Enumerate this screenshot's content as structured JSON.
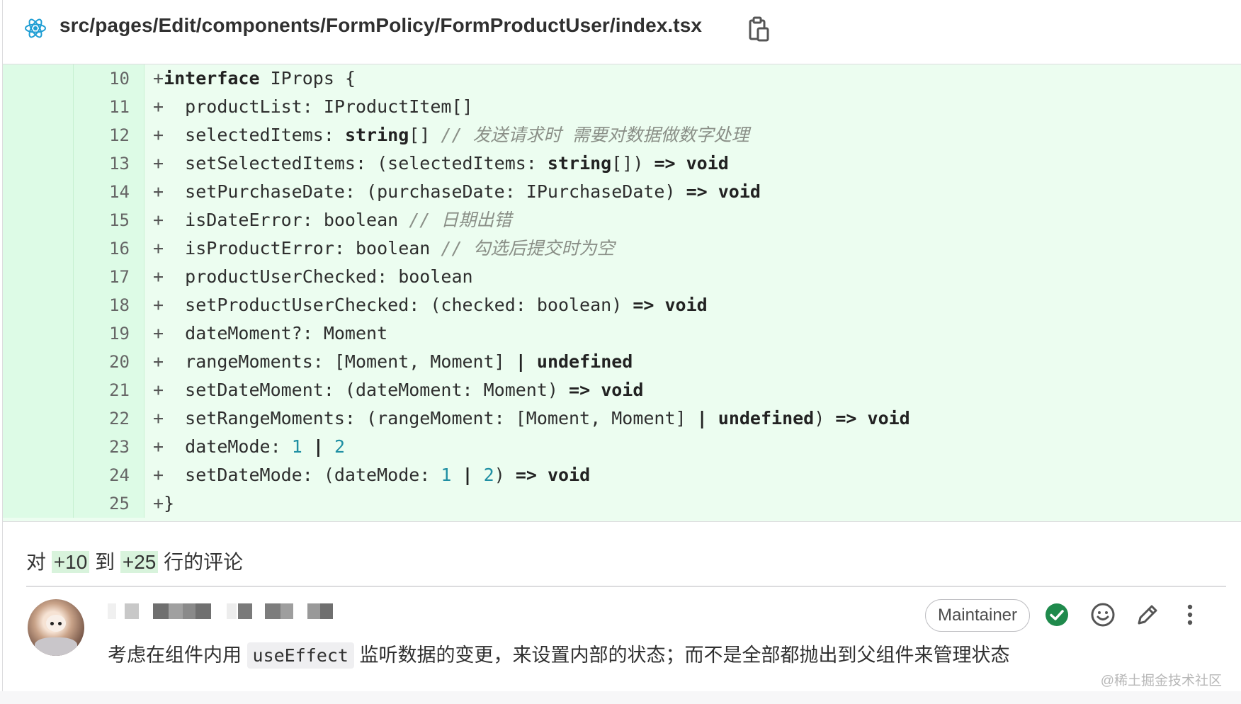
{
  "header": {
    "file_path": "src/pages/Edit/components/FormPolicy/FormProductUser/index.tsx",
    "file_icon": "react-icon",
    "copy_icon": "clipboard-icon"
  },
  "diff": {
    "lines": [
      {
        "new": "10",
        "sign": "+"
      },
      {
        "new": "11",
        "sign": "+"
      },
      {
        "new": "12",
        "sign": "+"
      },
      {
        "new": "13",
        "sign": "+"
      },
      {
        "new": "14",
        "sign": "+"
      },
      {
        "new": "15",
        "sign": "+"
      },
      {
        "new": "16",
        "sign": "+"
      },
      {
        "new": "17",
        "sign": "+"
      },
      {
        "new": "18",
        "sign": "+"
      },
      {
        "new": "19",
        "sign": "+"
      },
      {
        "new": "20",
        "sign": "+"
      },
      {
        "new": "21",
        "sign": "+"
      },
      {
        "new": "22",
        "sign": "+"
      },
      {
        "new": "23",
        "sign": "+"
      },
      {
        "new": "24",
        "sign": "+"
      },
      {
        "new": "25",
        "sign": "+"
      }
    ],
    "code": [
      [
        {
          "t": "+",
          "c": "plus"
        },
        {
          "t": "interface",
          "c": "kw"
        },
        {
          "t": " IProps {"
        }
      ],
      [
        {
          "t": "+",
          "c": "plus"
        },
        {
          "t": "  productList: IProductItem[]"
        }
      ],
      [
        {
          "t": "+",
          "c": "plus"
        },
        {
          "t": "  selectedItems: "
        },
        {
          "t": "string",
          "c": "kw"
        },
        {
          "t": "[] "
        },
        {
          "t": "// 发送请求时 需要对数据做数字处理",
          "c": "cm"
        }
      ],
      [
        {
          "t": "+",
          "c": "plus"
        },
        {
          "t": "  setSelectedItems: (selectedItems: "
        },
        {
          "t": "string",
          "c": "kw"
        },
        {
          "t": "[]) "
        },
        {
          "t": "=>",
          "c": "kw"
        },
        {
          "t": " "
        },
        {
          "t": "void",
          "c": "kw"
        }
      ],
      [
        {
          "t": "+",
          "c": "plus"
        },
        {
          "t": "  setPurchaseDate: (purchaseDate: IPurchaseDate) "
        },
        {
          "t": "=>",
          "c": "kw"
        },
        {
          "t": " "
        },
        {
          "t": "void",
          "c": "kw"
        }
      ],
      [
        {
          "t": "+",
          "c": "plus"
        },
        {
          "t": "  isDateError: boolean "
        },
        {
          "t": "// 日期出错",
          "c": "cm"
        }
      ],
      [
        {
          "t": "+",
          "c": "plus"
        },
        {
          "t": "  isProductError: boolean "
        },
        {
          "t": "// 勾选后提交时为空",
          "c": "cm"
        }
      ],
      [
        {
          "t": "+",
          "c": "plus"
        },
        {
          "t": "  productUserChecked: boolean"
        }
      ],
      [
        {
          "t": "+",
          "c": "plus"
        },
        {
          "t": "  setProductUserChecked: (checked: boolean) "
        },
        {
          "t": "=>",
          "c": "kw"
        },
        {
          "t": " "
        },
        {
          "t": "void",
          "c": "kw"
        }
      ],
      [
        {
          "t": "+",
          "c": "plus"
        },
        {
          "t": "  dateMoment?: Moment"
        }
      ],
      [
        {
          "t": "+",
          "c": "plus"
        },
        {
          "t": "  rangeMoments: [Moment, Moment] "
        },
        {
          "t": "|",
          "c": "kw"
        },
        {
          "t": " "
        },
        {
          "t": "undefined",
          "c": "kw"
        }
      ],
      [
        {
          "t": "+",
          "c": "plus"
        },
        {
          "t": "  setDateMoment: (dateMoment: Moment) "
        },
        {
          "t": "=>",
          "c": "kw"
        },
        {
          "t": " "
        },
        {
          "t": "void",
          "c": "kw"
        }
      ],
      [
        {
          "t": "+",
          "c": "plus"
        },
        {
          "t": "  setRangeMoments: (rangeMoment: [Moment, Moment] "
        },
        {
          "t": "|",
          "c": "kw"
        },
        {
          "t": " "
        },
        {
          "t": "undefined",
          "c": "kw"
        },
        {
          "t": ") "
        },
        {
          "t": "=>",
          "c": "kw"
        },
        {
          "t": " "
        },
        {
          "t": "void",
          "c": "kw"
        }
      ],
      [
        {
          "t": "+",
          "c": "plus"
        },
        {
          "t": "  dateMode: "
        },
        {
          "t": "1",
          "c": "num"
        },
        {
          "t": " "
        },
        {
          "t": "|",
          "c": "kw"
        },
        {
          "t": " "
        },
        {
          "t": "2",
          "c": "num"
        }
      ],
      [
        {
          "t": "+",
          "c": "plus"
        },
        {
          "t": "  setDateMode: (dateMode: "
        },
        {
          "t": "1",
          "c": "num"
        },
        {
          "t": " "
        },
        {
          "t": "|",
          "c": "kw"
        },
        {
          "t": " "
        },
        {
          "t": "2",
          "c": "num"
        },
        {
          "t": ") "
        },
        {
          "t": "=>",
          "c": "kw"
        },
        {
          "t": " "
        },
        {
          "t": "void",
          "c": "kw"
        }
      ],
      [
        {
          "t": "+",
          "c": "plus"
        },
        {
          "t": "}"
        }
      ]
    ]
  },
  "comment_summary": {
    "prefix": "对",
    "from": "+10",
    "middle": "到",
    "to": "+25",
    "suffix": "行的评论"
  },
  "comment": {
    "avatar_icon": "avatar",
    "role_badge": "Maintainer",
    "body_before": "考虑在组件内用",
    "body_code": "useEffect",
    "body_after": "监听数据的变更，来设置内部的状态；而不是全部都抛出到父组件来管理状态",
    "actions": [
      "resolve-check-icon",
      "emoji-icon",
      "edit-pencil-icon",
      "more-vertical-icon"
    ]
  },
  "watermark": "@稀土掘金技术社区",
  "colors": {
    "diff_bg": "#ecfdf0",
    "gutter_bg": "#ddfbe6",
    "resolve_green": "#1f8a4c",
    "comment_gray": "#8a8f87"
  }
}
